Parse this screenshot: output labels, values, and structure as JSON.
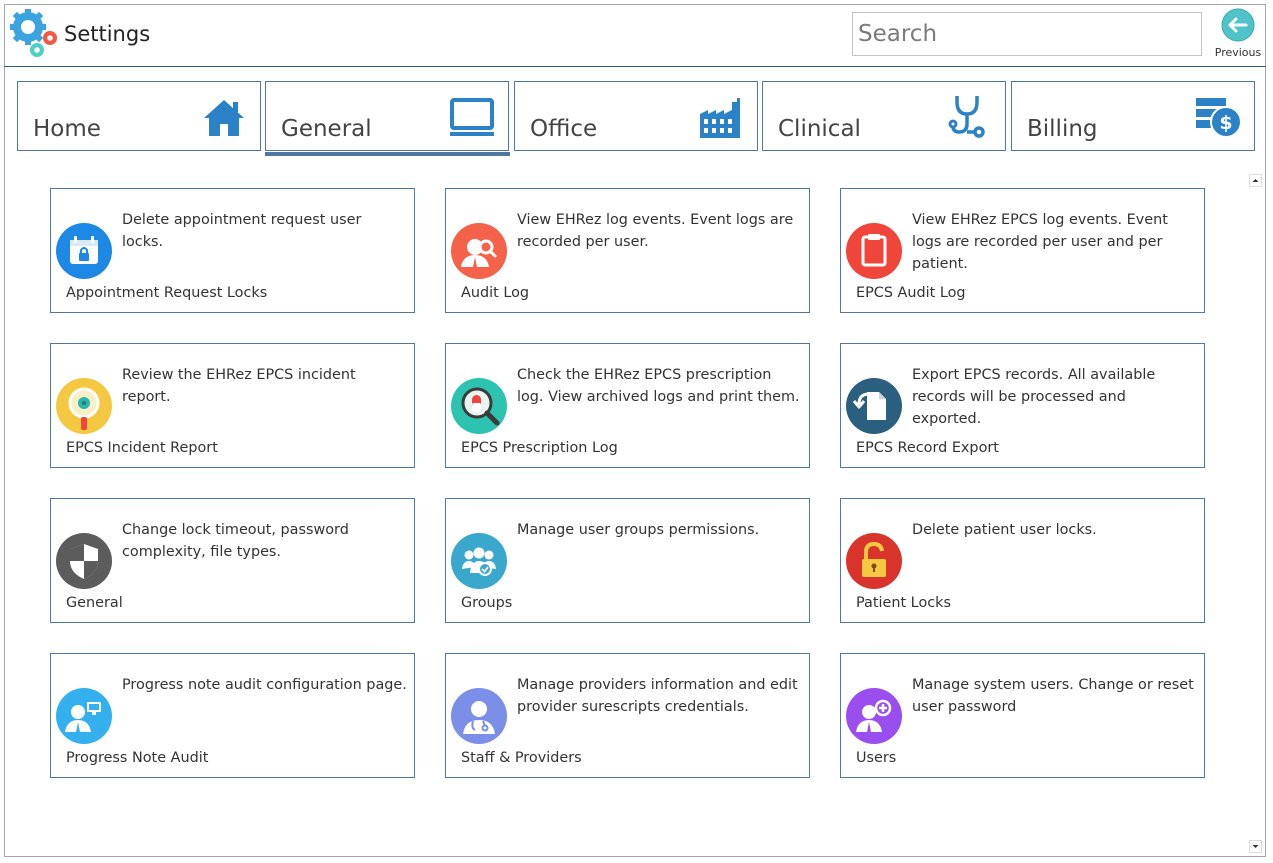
{
  "header": {
    "title": "Settings",
    "logo_icon": "gears-icon",
    "search_placeholder": "Search",
    "previous_label": "Previous"
  },
  "colors": {
    "accent": "#4e78a0",
    "tab_icon": "#2b82c6",
    "previous_button": "#4fc3c8"
  },
  "tabs": [
    {
      "label": "Home",
      "icon": "house-icon",
      "selected": false
    },
    {
      "label": "General",
      "icon": "monitor-icon",
      "selected": true
    },
    {
      "label": "Office",
      "icon": "factory-icon",
      "selected": false
    },
    {
      "label": "Clinical",
      "icon": "stethoscope-icon",
      "selected": false
    },
    {
      "label": "Billing",
      "icon": "billing-money-icon",
      "selected": false
    }
  ],
  "cards": [
    {
      "title": "Appointment Request Locks",
      "description": "Delete appointment request user locks.",
      "icon": "calendar-lock-icon",
      "icon_color": "#1e88e5"
    },
    {
      "title": "Audit Log",
      "description": "View EHRez log events. Event logs are recorded per user.",
      "icon": "user-search-icon",
      "icon_color": "#f4624a"
    },
    {
      "title": "EPCS Audit Log",
      "description": "View EHRez EPCS log events. Event logs are recorded per user and per patient.",
      "icon": "clipboard-icon",
      "icon_color": "#f0453a"
    },
    {
      "title": "EPCS Incident Report",
      "description": "Review the EHRez EPCS incident report.",
      "icon": "magnifier-virus-icon",
      "icon_color": "#f5c842"
    },
    {
      "title": "EPCS Prescription Log",
      "description": "Check the EHRez EPCS prescription log. View archived logs and print them.",
      "icon": "magnifier-pill-icon",
      "icon_color": "#2cc4b0"
    },
    {
      "title": "EPCS Record Export",
      "description": "Export EPCS records. All available records will be processed and exported.",
      "icon": "file-export-icon",
      "icon_color": "#2b5f80"
    },
    {
      "title": "General",
      "description": "Change lock timeout, password complexity, file types.",
      "icon": "shield-icon",
      "icon_color": "#5c5c5c"
    },
    {
      "title": "Groups",
      "description": "Manage user groups permissions.",
      "icon": "group-users-icon",
      "icon_color": "#3aa8cc"
    },
    {
      "title": "Patient Locks",
      "description": "Delete patient user locks.",
      "icon": "padlock-icon",
      "icon_color": "#d9342b"
    },
    {
      "title": "Progress Note Audit",
      "description": "Progress note audit configuration page.",
      "icon": "user-monitor-icon",
      "icon_color": "#35b0ee"
    },
    {
      "title": "Staff & Providers",
      "description": "Manage providers information and edit provider surescripts credentials.",
      "icon": "doctor-icon",
      "icon_color": "#7b8ee8"
    },
    {
      "title": "Users",
      "description": "Manage system users. Change or reset user password",
      "icon": "user-add-icon",
      "icon_color": "#9b4ef0"
    }
  ]
}
